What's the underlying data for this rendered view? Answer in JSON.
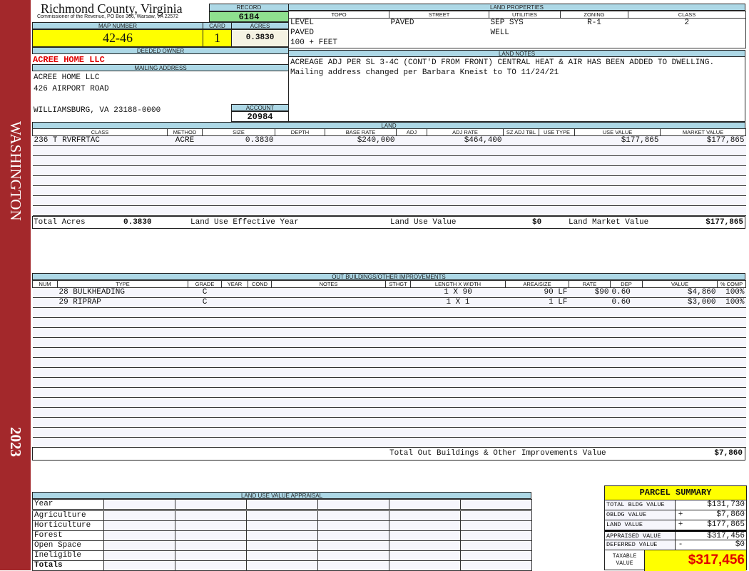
{
  "sidebar": {
    "locality": "WASHINGTON",
    "year": "2023"
  },
  "header": {
    "county": "Richmond County, Virginia",
    "office": "Commissioner of the Revenue, PO Box 366, Warsaw, VA 22572",
    "record_label": "RECORD",
    "record": "6184",
    "map_label": "MAP NUMBER",
    "map_number": "42-46",
    "card_label": "CARD",
    "card": "1",
    "acres_label": "ACRES",
    "acres": "0.3830"
  },
  "owner": {
    "deeded_label": "DEEDED OWNER",
    "deeded_owner": "ACREE HOME LLC",
    "mailing_label": "MAILING ADDRESS",
    "address": [
      "ACREE HOME LLC",
      "426 AIRPORT ROAD",
      "",
      "WILLIAMSBURG, VA 23188-0000"
    ],
    "account_label": "ACCOUNT",
    "account": "20984"
  },
  "land_properties": {
    "title": "LAND PROPERTIES",
    "columns": [
      "TOPO",
      "STREET",
      "UTILITIES",
      "ZONING",
      "CLASS"
    ],
    "rows": [
      [
        "LEVEL",
        "PAVED",
        "SEP SYS",
        "R-1",
        "2"
      ],
      [
        "PAVED",
        "",
        "WELL",
        "",
        ""
      ],
      [
        "100 + FEET",
        "",
        "",
        "",
        ""
      ]
    ]
  },
  "land_notes": {
    "title": "LAND NOTES",
    "text": "ACREAGE ADJ PER SL 3-4C (CONT'D FROM FRONT) CENTRAL HEAT & AIR HAS BEEN ADDED TO DWELLING. Mailing address changed per Barbara Kneist to TO 11/24/21"
  },
  "land": {
    "title": "LAND",
    "columns": [
      "CLASS",
      "METHOD",
      "SIZE",
      "DEPTH",
      "BASE RATE",
      "ADJ",
      "ADJ RATE",
      "SZ ADJ TBL",
      "USE TYPE",
      "USE VALUE",
      "MARKET VALUE"
    ],
    "rows": [
      [
        "236 T RVRFRTAC",
        "ACRE",
        "0.3830",
        "",
        "$240,000",
        "",
        "$464,400",
        "",
        "",
        "$177,865",
        "$177,865"
      ]
    ],
    "totals": {
      "acres_label": "Total Acres",
      "acres": "0.3830",
      "effective_year_label": "Land Use Effective Year",
      "effective_year": "",
      "use_value_label": "Land Use Value",
      "use_value": "$0",
      "market_value_label": "Land Market Value",
      "market_value": "$177,865"
    }
  },
  "outbuildings": {
    "title": "OUT BUILDINGS/OTHER IMPROVEMENTS",
    "columns": [
      "NUM",
      "TYPE",
      "GRADE",
      "YEAR",
      "COND",
      "NOTES",
      "STHGT",
      "LENGTH X WIDTH",
      "AREA/SIZE",
      "RATE",
      "DEP",
      "VALUE",
      "% COMP"
    ],
    "rows": [
      [
        "",
        "28 BULKHEADING",
        "C",
        "",
        "",
        "",
        "",
        "1 X 90",
        "90 LF",
        "$90",
        "0.60",
        "$4,860",
        "100%"
      ],
      [
        "",
        "29 RIPRAP",
        "C",
        "",
        "",
        "",
        "",
        "1 X 1",
        "1 LF",
        "",
        "0.60",
        "$3,000",
        "100%"
      ]
    ],
    "total_label": "Total Out Buildings & Other Improvements Value",
    "total": "$7,860"
  },
  "land_use_appraisal": {
    "title": "LAND USE VALUE APPRAISAL",
    "year_label": "Year",
    "rows": [
      "Agriculture",
      "Horticulture",
      "Forest",
      "Open Space",
      "Ineligible"
    ],
    "totals_label": "Totals"
  },
  "parcel_summary": {
    "title": "PARCEL SUMMARY",
    "rows": [
      {
        "label": "TOTAL BLDG VALUE",
        "sign": "",
        "value": "$131,730"
      },
      {
        "label": "OBLDG VALUE",
        "sign": "+",
        "value": "$7,860"
      },
      {
        "label": "LAND VALUE",
        "sign": "+",
        "value": "$177,865"
      },
      {
        "label": "APPRAISED VALUE",
        "sign": "",
        "value": "$317,456"
      },
      {
        "label": "DEFERRED VALUE",
        "sign": "-",
        "value": "$0"
      }
    ],
    "taxable_label": "TAXABLE VALUE",
    "taxable_value": "$317,456"
  },
  "colors": {
    "sidebar": "#a3282b",
    "header": "#add8e6",
    "highlight": "#ffff00",
    "record": "#8fe08f",
    "owner": "#e00000"
  }
}
